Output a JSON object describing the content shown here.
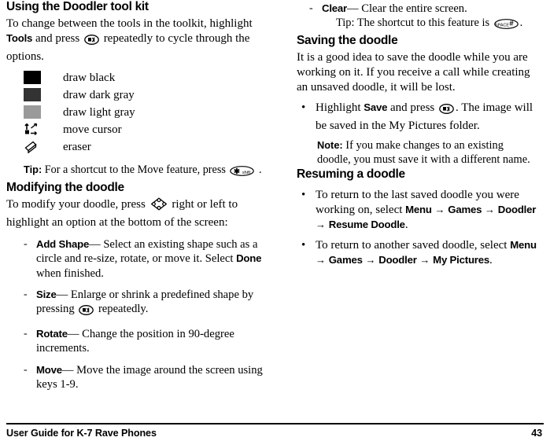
{
  "document": {
    "footer_title": "User Guide for K-7 Rave Phones",
    "page_number": "43"
  },
  "left_column": {
    "section1": {
      "heading": "Using the Doodler tool kit",
      "intro_part1": "To change between the tools in the toolkit, highlight ",
      "intro_bold1": "Tools",
      "intro_part2": " and press ",
      "intro_icon": "ok-key-icon",
      "intro_part3": " repeatedly to cycle through the options.",
      "tools": [
        {
          "icon": "black-swatch-icon",
          "color": "#000000",
          "label": "draw black"
        },
        {
          "icon": "dark-gray-swatch-icon",
          "color": "#333333",
          "label": "draw dark gray"
        },
        {
          "icon": "light-gray-swatch-icon",
          "color": "#9a9a9a",
          "label": "draw light gray"
        },
        {
          "icon": "move-cursor-icon",
          "color": "",
          "label": "move cursor"
        },
        {
          "icon": "eraser-icon",
          "color": "",
          "label": "eraser"
        }
      ],
      "tip_label": "Tip:",
      "tip_text_part1": " For a shortcut to the Move feature, press ",
      "tip_icon": "star-shift-key-icon",
      "tip_text_part2": " ."
    },
    "section2": {
      "heading": "Modifying the doodle",
      "intro_part1": "To modify your doodle, press ",
      "intro_icon": "navigation-pad-icon",
      "intro_part2": " right or left to highlight an option at the bottom of the screen:",
      "items": [
        {
          "term": "Add Shape",
          "dash": "—",
          "text_part1": " Select an existing shape such as a circle and re-size, rotate, or move it. Select ",
          "bold_inline": "Done",
          "text_part2": " when finished."
        },
        {
          "term": "Size",
          "dash": "—",
          "text_part1": " Enlarge or shrink a predefined shape by pressing ",
          "icon": "ok-key-icon",
          "text_part2": " repeatedly."
        },
        {
          "term": "Rotate",
          "dash": "—",
          "text_part1": " Change the position in 90-degree increments."
        },
        {
          "term": "Move",
          "dash": "—",
          "text_part1": " Move the image around the screen using keys 1-9."
        }
      ]
    }
  },
  "right_column": {
    "clear_item": {
      "dash_mark": "-",
      "term": "Clear",
      "dash": "—",
      "text": " Clear the entire screen.",
      "tip_label": "Tip:",
      "tip_text": " The shortcut to this feature is ",
      "tip_icon": "pound-space-key-icon",
      "tip_end": "."
    },
    "section_saving": {
      "heading": "Saving the doodle",
      "intro": "It is a good idea to save the doodle while you are working on it. If you receive a call while creating an unsaved doodle, it will be lost.",
      "bullet": {
        "text_part1": "Highlight ",
        "bold1": "Save",
        "text_part2": " and press ",
        "icon": "ok-key-icon",
        "text_part3": ". The image will be saved in the My Pictures folder."
      },
      "note_label": "Note:",
      "note_text": " If you make changes to an existing doodle, you must save it with a different name."
    },
    "section_resuming": {
      "heading": "Resuming a doodle",
      "bullets": [
        {
          "text_part1": "To return to the last saved doodle you were working on, select ",
          "path": [
            "Menu",
            "Games",
            "Doodler",
            "Resume Doodle"
          ],
          "arrow": "→",
          "text_end": "."
        },
        {
          "text_part1": "To return to another saved doodle, select ",
          "path": [
            "Menu",
            "Games",
            "Doodler",
            "My Pictures"
          ],
          "arrow": "→",
          "text_end": "."
        }
      ]
    }
  }
}
